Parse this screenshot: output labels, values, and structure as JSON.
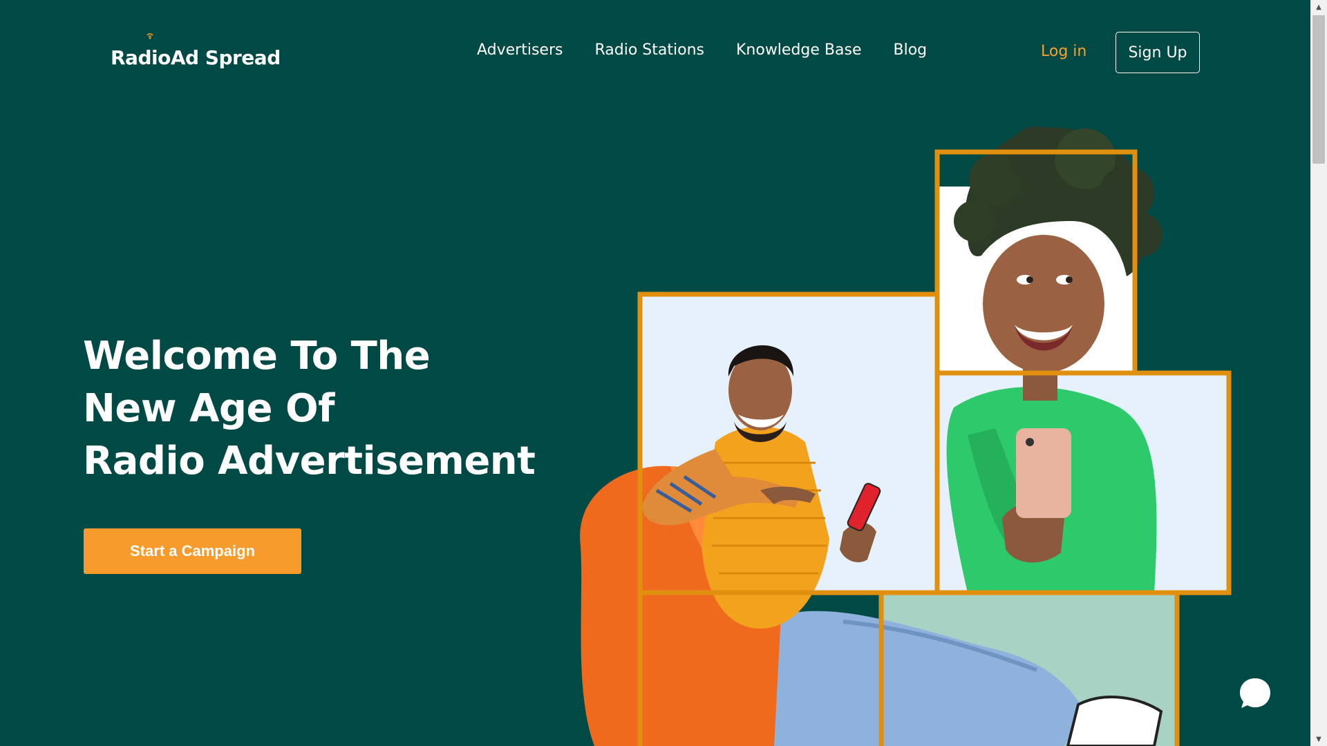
{
  "brand": {
    "logo_text": "RadioAd Spread"
  },
  "nav": {
    "items": [
      {
        "label": "Advertisers"
      },
      {
        "label": "Radio Stations"
      },
      {
        "label": "Knowledge Base"
      },
      {
        "label": "Blog"
      }
    ],
    "login_label": "Log in",
    "signup_label": "Sign Up"
  },
  "hero": {
    "title_lines": [
      "Welcome To The",
      "New Age Of",
      "Radio Advertisement"
    ],
    "cta_label": "Start a Campaign"
  },
  "colors": {
    "background": "#014944",
    "accent_orange": "#f79b2c",
    "frame_orange": "#e0900e",
    "login_text": "#f5a230"
  },
  "icons": {
    "chat": "chat-bubble-icon",
    "antenna": "antenna-icon"
  }
}
